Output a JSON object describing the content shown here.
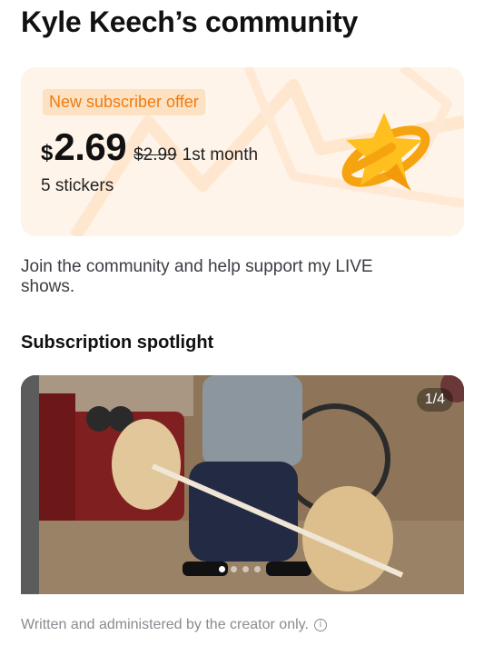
{
  "page": {
    "title": "Kyle Keech’s community"
  },
  "offer": {
    "badge": "New subscriber offer",
    "currency": "$",
    "price": "2.69",
    "original_price": "$2.99",
    "period": "1st month",
    "stickers": "5 stickers",
    "accent_color": "#f07b11",
    "card_color": "#fff4e9",
    "icon": "star-ring-icon"
  },
  "description": "Join the community and help support my LIVE shows.",
  "spotlight": {
    "title": "Subscription spotlight",
    "counter": "1/4",
    "slide_count": 4,
    "active_slide": 1
  },
  "footer": {
    "note": "Written and administered by the creator only.",
    "icon": "info-icon"
  }
}
